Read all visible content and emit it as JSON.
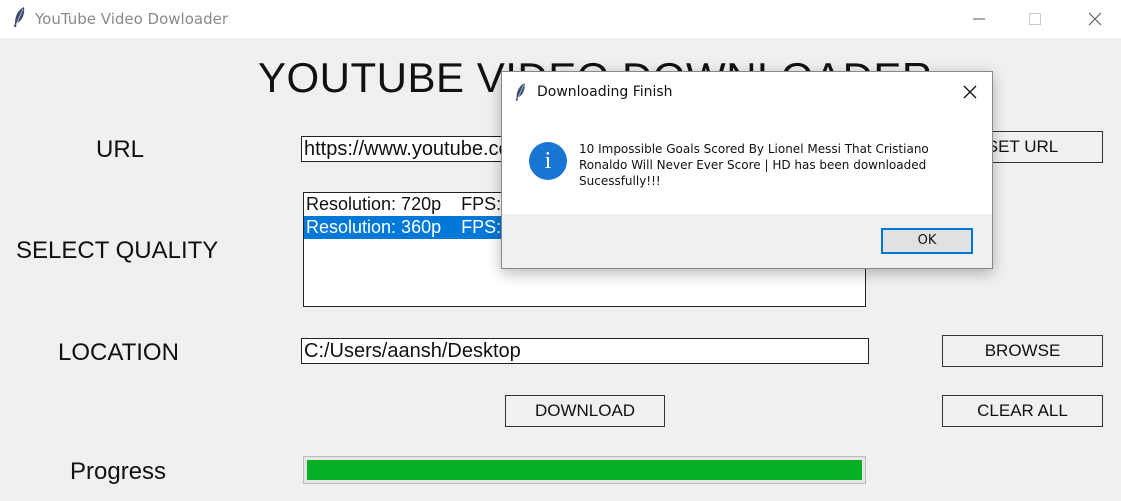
{
  "window": {
    "title": "YouTube Video Dowloader",
    "icon": "feather-icon"
  },
  "app": {
    "heading": "YOUTUBE VIDEO DOWNLOADER",
    "url_label": "URL",
    "url_value": "https://www.youtube.com/watch?v=",
    "set_url_button": "SET URL",
    "quality_label": "SELECT QUALITY",
    "quality_options": [
      "Resolution: 720p    FPS: 30",
      "Resolution: 360p    FPS: 30"
    ],
    "selected_quality_index": 1,
    "location_label": "LOCATION",
    "location_value": "C:/Users/aansh/Desktop",
    "browse_button": "BROWSE",
    "download_button": "DOWNLOAD",
    "clear_all_button": "CLEAR ALL",
    "progress_label": "Progress",
    "progress_percent": 100,
    "progress_color": "#06b025"
  },
  "dialog": {
    "title": "Downloading Finish",
    "icon": "info-icon",
    "message": "10 Impossible Goals Scored By Lionel Messi That Cristiano Ronaldo Will Never Ever Score | HD has been downloaded Sucessfully!!!",
    "ok_label": "OK"
  }
}
